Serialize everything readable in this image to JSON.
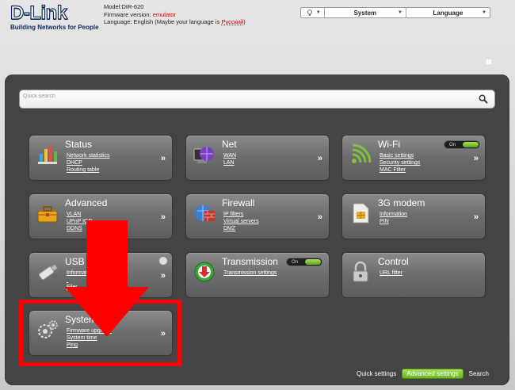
{
  "header": {
    "brand": "D-Link",
    "tagline": "Building Networks for People",
    "model_line": "Model:DIR-620",
    "firmware_label": "Firmware version: ",
    "firmware_value": "emulator",
    "language_line": "Language: English (Maybe your language is ",
    "language_suggest": "Русский",
    "language_end": ")"
  },
  "topbar": {
    "tools_icon": "lamp-icon",
    "system_label": "System",
    "language_label": "Language"
  },
  "search": {
    "placeholder": "Quick search",
    "icon": "magnifier-icon"
  },
  "tiles": {
    "status": {
      "title": "Status",
      "links": [
        "Network statistics",
        "DHCP",
        "Routing table"
      ]
    },
    "net": {
      "title": "Net",
      "links": [
        "WAN",
        "LAN"
      ]
    },
    "wifi": {
      "title": "Wi-Fi",
      "links": [
        "Basic settings",
        "Security settings",
        "MAC Filter"
      ],
      "toggle": "On"
    },
    "advanced": {
      "title": "Advanced",
      "links": [
        "VLAN",
        "UPnP IGD",
        "DDNS"
      ]
    },
    "firewall": {
      "title": "Firewall",
      "links": [
        "IP filters",
        "Virtual servers",
        "DMZ"
      ]
    },
    "modem": {
      "title": "3G modem",
      "links": [
        "Information",
        "PIN"
      ]
    },
    "usb": {
      "title": "USB",
      "links": [
        "Information",
        "",
        "Filer"
      ]
    },
    "transmission": {
      "title": "Transmission",
      "links": [
        "Transmission settings"
      ],
      "toggle": "On"
    },
    "control": {
      "title": "Control",
      "links": [
        "URL filter"
      ]
    },
    "system": {
      "title": "System",
      "links": [
        "Firmware upgrade",
        "System time",
        "Ping"
      ]
    }
  },
  "chevron": "»",
  "bottom": {
    "quick": "Quick settings",
    "advanced": "Advanced settings",
    "search": "Search"
  },
  "colors": {
    "panel": "#444444",
    "accent_green": "#7cc23a",
    "annotation_red": "#ff0000",
    "brand_blue": "#0b2a5a"
  }
}
